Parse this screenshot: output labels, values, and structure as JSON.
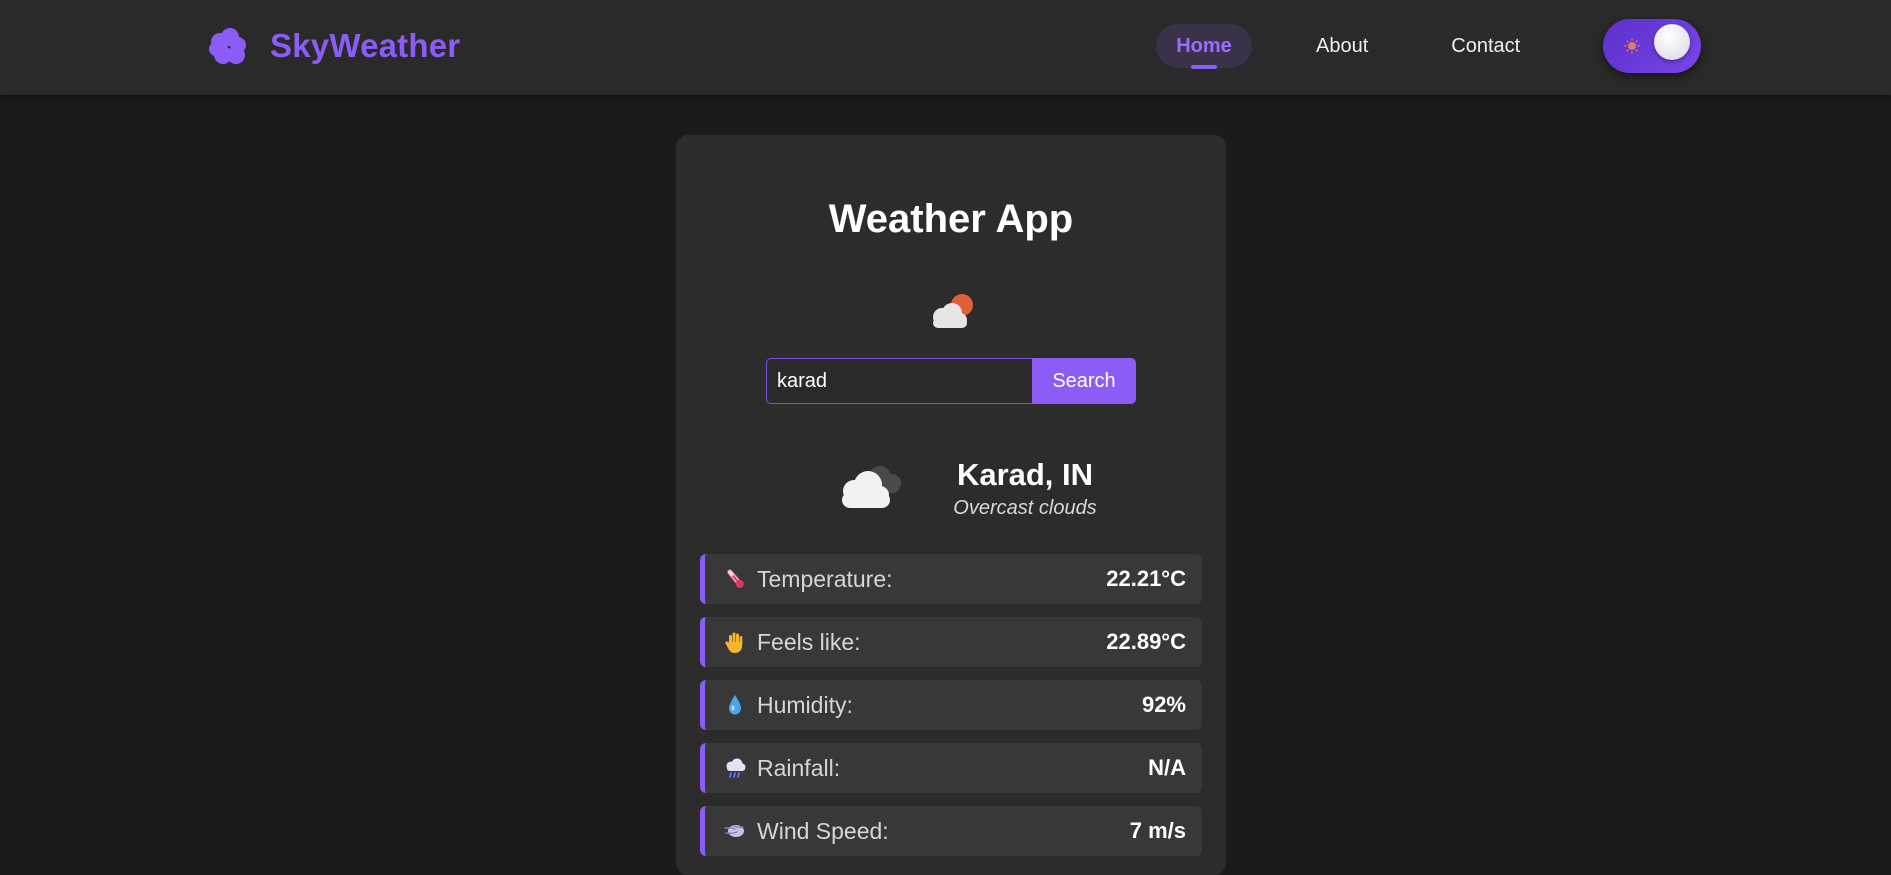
{
  "navbar": {
    "brand_name": "SkyWeather",
    "brand_icon": "cloud-icon",
    "links": [
      {
        "label": "Home",
        "active": true
      },
      {
        "label": "About",
        "active": false
      },
      {
        "label": "Contact",
        "active": false
      }
    ],
    "theme_toggle": {
      "icon_off": "sun-icon",
      "state": "dark"
    }
  },
  "main": {
    "title": "Weather App",
    "title_icon": "cloud-sun-icon",
    "search": {
      "value": "karad",
      "button_label": "Search"
    },
    "location": {
      "city": "Karad, IN",
      "description": "Overcast clouds",
      "icon": "overcast-clouds-icon"
    },
    "stats": [
      {
        "icon": "thermometer-icon",
        "label": "Temperature:",
        "value": "22.21°C"
      },
      {
        "icon": "hand-icon",
        "label": "Feels like:",
        "value": "22.89°C"
      },
      {
        "icon": "droplet-icon",
        "label": "Humidity:",
        "value": "92%"
      },
      {
        "icon": "rain-cloud-icon",
        "label": "Rainfall:",
        "value": "N/A"
      },
      {
        "icon": "wind-icon",
        "label": "Wind Speed:",
        "value": "7 m/s"
      }
    ]
  },
  "colors": {
    "accent": "#8b5cf6",
    "background": "#1b1b1b",
    "navbar": "#2a2a2a",
    "card": "#2c2c2c",
    "stat_row": "#383838"
  }
}
